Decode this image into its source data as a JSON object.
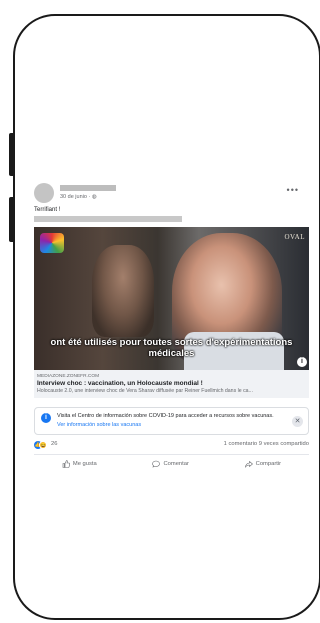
{
  "post": {
    "date": "30 de junio · ",
    "text": "Terrifiant !",
    "more_icon": "•••"
  },
  "video": {
    "subtitle": "ont été utilisés pour toutes sortes d'expérimentations médicales",
    "brand": "OVAL",
    "info_icon": "i"
  },
  "link": {
    "domain": "MEDIAZONE.ZONEFR.COM",
    "title": "Interview choc : vaccination, un Holocauste mondial !",
    "description": "Holocauste 2.0, une interview choc de Vera Sharav diffusée par Reiner Fuellmich dans le ca..."
  },
  "covid_notice": {
    "icon": "i",
    "text": "Visita el Centro de información sobre COVID-19 para acceder a recursos sobre vacunas.",
    "link": "Ver información sobre las vacunas",
    "close_icon": "✕"
  },
  "stats": {
    "reaction_count": "26",
    "comments_shares": "1 comentario 9 veces compartido",
    "like_icon": "👍",
    "haha_icon": "😆"
  },
  "actions": {
    "like": "Me gusta",
    "comment": "Comentar",
    "share": "Compartir"
  }
}
